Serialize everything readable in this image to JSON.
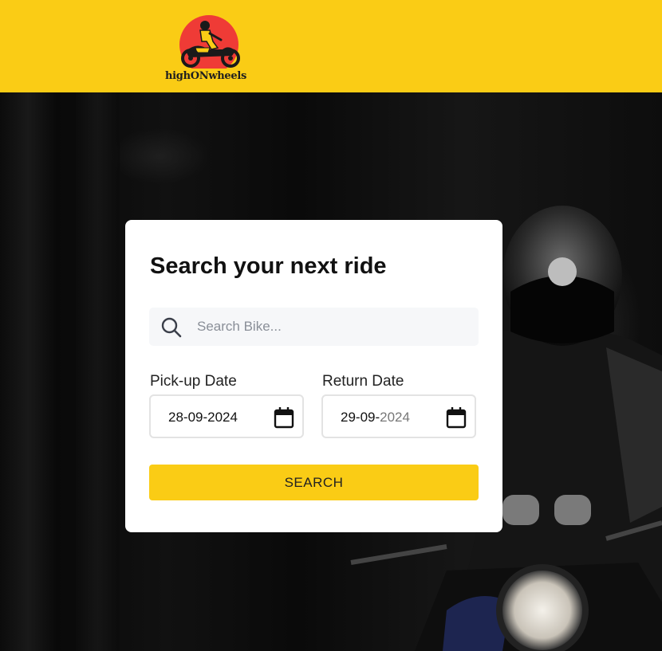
{
  "brand": {
    "name": "highONwheels"
  },
  "search_card": {
    "title": "Search your next ride",
    "search": {
      "placeholder": "Search Bike...",
      "value": ""
    },
    "pickup": {
      "label": "Pick-up Date",
      "day_month": "28-09-",
      "year": "2024"
    },
    "return": {
      "label": "Return Date",
      "day_month": "29-09-",
      "year": "2024"
    },
    "submit_label": "SEARCH"
  },
  "colors": {
    "header": "#facc15",
    "button": "#facc15",
    "logo_sun": "#ef3b36",
    "background": "#000000"
  },
  "icons": [
    "search-icon",
    "calendar-icon",
    "motorcycle-icon"
  ]
}
